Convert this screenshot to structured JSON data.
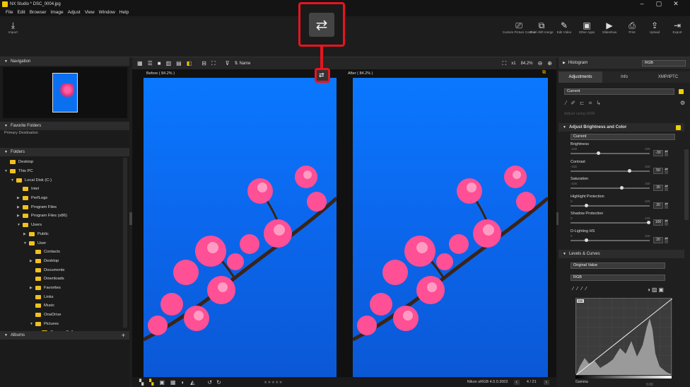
{
  "window": {
    "title": "NX Studio   * DSC_0004.jpg",
    "min": "–",
    "max": "▢",
    "close": "✕"
  },
  "menu": [
    "File",
    "Edit",
    "Browser",
    "Image",
    "Adjust",
    "View",
    "Window",
    "Help"
  ],
  "toolbar": {
    "import": "Import",
    "right": [
      {
        "icon": "⎚",
        "label": "Custom Picture Control"
      },
      {
        "icon": "⧉",
        "label": "Pixel shift merge"
      },
      {
        "icon": "✎",
        "label": "Edit Video"
      },
      {
        "icon": "▣",
        "label": "Other Apps"
      },
      {
        "icon": "▶",
        "label": "Slideshow"
      },
      {
        "icon": "⎙",
        "label": "Print"
      },
      {
        "icon": "⇪",
        "label": "Upload"
      },
      {
        "icon": "⇥",
        "label": "Export"
      }
    ]
  },
  "left": {
    "navigation": "Navigation",
    "favorites": "Favorite Folders",
    "primary": "Primary Destination",
    "folders": "Folders",
    "albums": "Albums",
    "tree": [
      {
        "t": "Desktop",
        "l": 0,
        "a": ""
      },
      {
        "t": "This PC",
        "l": 0,
        "a": "▼"
      },
      {
        "t": "Local Disk (C:)",
        "l": 1,
        "a": "▼"
      },
      {
        "t": "Intel",
        "l": 2,
        "a": ""
      },
      {
        "t": "PerfLogs",
        "l": 2,
        "a": "▶"
      },
      {
        "t": "Program Files",
        "l": 2,
        "a": "▶"
      },
      {
        "t": "Program Files (x86)",
        "l": 2,
        "a": "▶"
      },
      {
        "t": "Users",
        "l": 2,
        "a": "▼"
      },
      {
        "t": "Public",
        "l": 3,
        "a": "▶"
      },
      {
        "t": "User",
        "l": 3,
        "a": "▼"
      },
      {
        "t": "Contacts",
        "l": 4,
        "a": ""
      },
      {
        "t": "Desktop",
        "l": 4,
        "a": "▶"
      },
      {
        "t": "Documents",
        "l": 4,
        "a": ""
      },
      {
        "t": "Downloads",
        "l": 4,
        "a": ""
      },
      {
        "t": "Favorites",
        "l": 4,
        "a": "▶"
      },
      {
        "t": "Links",
        "l": 4,
        "a": ""
      },
      {
        "t": "Music",
        "l": 4,
        "a": ""
      },
      {
        "t": "OneDrive",
        "l": 4,
        "a": ""
      },
      {
        "t": "Pictures",
        "l": 4,
        "a": "▼"
      },
      {
        "t": "Camera Roll",
        "l": 5,
        "a": ""
      }
    ]
  },
  "center": {
    "sort": "Name",
    "zoom": "84.2%",
    "x1": "x1",
    "before": "Before ( 84.2% )",
    "after": "After ( 84.2% )",
    "profile": "Nikon sRGB 4.0.0.3002",
    "page": "4 / 21",
    "stars": "★★★★★"
  },
  "right": {
    "histogram": "Histogram",
    "channel": "RGB",
    "tabs": [
      "Adjustments",
      "Info",
      "XMP/IPTC"
    ],
    "preset": "Current",
    "hdr": "Adjust using HDR",
    "abc": "Adjust Brightness and Color",
    "abcpreset": "Current",
    "sliders": [
      {
        "name": "Brightness",
        "min": "-100",
        "max": "100",
        "val": "-30"
      },
      {
        "name": "Contrast",
        "min": "-100",
        "max": "100",
        "val": "50"
      },
      {
        "name": "Saturation",
        "min": "-100",
        "max": "100",
        "val": "30"
      },
      {
        "name": "Highlight Protection",
        "min": "0",
        "max": "100",
        "val": "20"
      },
      {
        "name": "Shadow Protection",
        "min": "0",
        "max": "100",
        "val": "100"
      },
      {
        "name": "D-Lighting HS",
        "min": "0",
        "max": "100",
        "val": "20"
      }
    ],
    "levels": "Levels & Curves",
    "lvpreset": "Original Value",
    "lvchan": "RGB",
    "gamma": "Gamma",
    "gammaval": "0.00",
    "hist255": "255"
  }
}
